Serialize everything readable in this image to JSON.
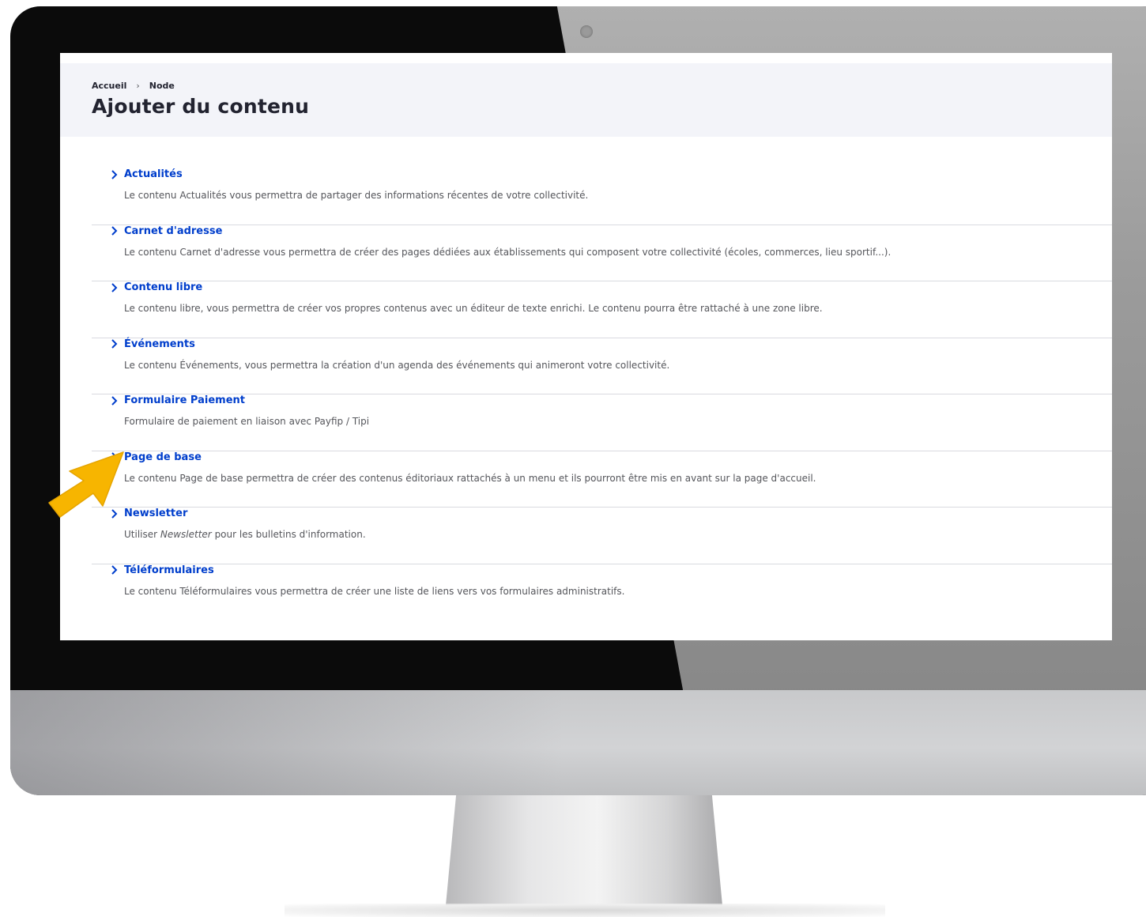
{
  "breadcrumb": {
    "items": [
      "Accueil",
      "Node"
    ],
    "separator": "›"
  },
  "page": {
    "title": "Ajouter du contenu"
  },
  "content_types": [
    {
      "label": "Actualités",
      "description": "Le contenu Actualités vous permettra de partager des informations récentes de votre collectivité."
    },
    {
      "label": "Carnet d'adresse",
      "description": "Le contenu Carnet d'adresse vous permettra de créer des pages dédiées aux établissements qui composent votre collectivité (écoles, commerces, lieu sportif...)."
    },
    {
      "label": "Contenu libre",
      "description": "Le contenu libre, vous permettra de créer vos propres contenus avec un éditeur de texte enrichi. Le contenu pourra être rattaché à une zone libre."
    },
    {
      "label": "Événements",
      "description": "Le contenu Événements, vous permettra la création d'un agenda des événements qui animeront votre collectivité."
    },
    {
      "label": "Formulaire Paiement",
      "description": "Formulaire de paiement en liaison avec Payfip / Tipi"
    },
    {
      "label": "Page de base",
      "description": "Le contenu Page de base permettra de créer des contenus éditoriaux rattachés à un menu et ils pourront être mis en avant sur la page d'accueil."
    },
    {
      "label": "Newsletter",
      "description_prefix": "Utiliser ",
      "description_emphasis": "Newsletter",
      "description_suffix": " pour les bulletins d'information."
    },
    {
      "label": "Téléformulaires",
      "description": "Le contenu Téléformulaires vous permettra de créer une liste de liens vers vos formulaires administratifs."
    }
  ],
  "colors": {
    "link": "#003ecc",
    "text": "#55565b",
    "header_bg": "#f3f4f9",
    "arrow": "#f7b500"
  },
  "icons": {
    "item_chevron": "chevron-right-icon",
    "pointer": "pointer-arrow-icon"
  }
}
